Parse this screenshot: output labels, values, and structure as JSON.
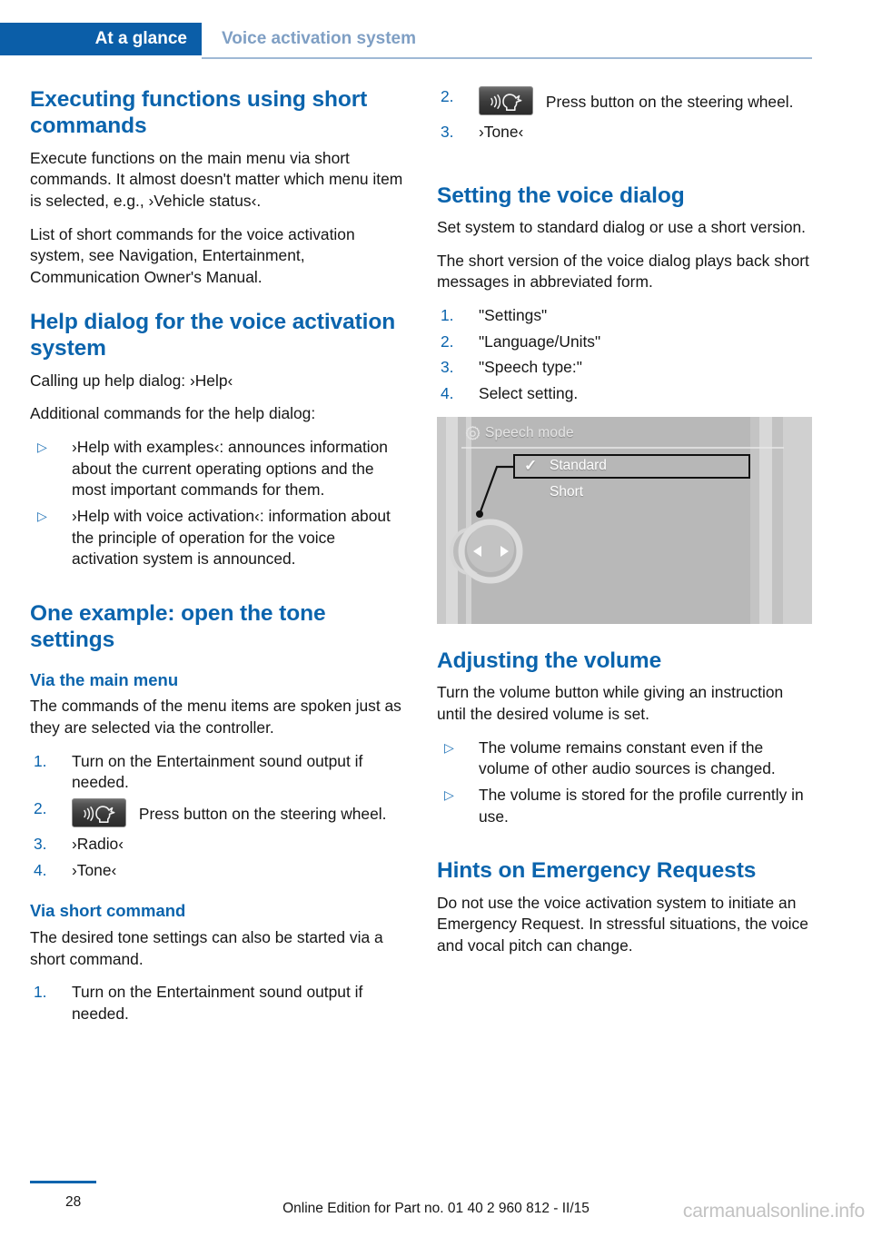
{
  "header": {
    "tab_label": "At a glance",
    "chapter_label": "Voice activation system"
  },
  "colors": {
    "brand_blue": "#0b64ad",
    "tab_blue": "#0b5ea8",
    "chapter_gray_blue": "#7f9fc4"
  },
  "left_column": {
    "section1": {
      "heading": "Executing functions using short commands",
      "paragraphs": [
        "Execute functions on the main menu via short commands. It almost doesn't matter which menu item is selected, e.g., ›Vehicle status‹.",
        "List of short commands for the voice activation system, see Navigation, Entertainment, Communication Owner's Manual."
      ]
    },
    "section2": {
      "heading": "Help dialog for the voice activation system",
      "paragraphs": [
        "Calling up help dialog: ›Help‹",
        "Additional commands for the help dialog:"
      ],
      "bullets": [
        "›Help with examples‹: announces information about the current operating options and the most important commands for them.",
        "›Help with voice activation‹: information about the principle of operation for the voice activation system is announced."
      ]
    },
    "section3": {
      "heading": "One example: open the tone settings",
      "sub1": {
        "heading": "Via the main menu",
        "paragraph": "The commands of the menu items are spoken just as they are selected via the controller.",
        "steps": [
          {
            "num": "1.",
            "text": "Turn on the Entertainment sound output if needed.",
            "icon": null
          },
          {
            "num": "2.",
            "text": "Press button on the steering wheel.",
            "icon": "voice-button-icon"
          },
          {
            "num": "3.",
            "text": "›Radio‹",
            "icon": null
          },
          {
            "num": "4.",
            "text": "›Tone‹",
            "icon": null
          }
        ]
      },
      "sub2": {
        "heading": "Via short command",
        "paragraph": "The desired tone settings can also be started via a short command.",
        "steps": [
          {
            "num": "1.",
            "text": "Turn on the Entertainment sound output if needed.",
            "icon": null
          }
        ]
      }
    }
  },
  "right_column": {
    "continued_steps": [
      {
        "num": "2.",
        "text": "Press button on the steering wheel.",
        "icon": "voice-button-icon"
      },
      {
        "num": "3.",
        "text": "›Tone‹",
        "icon": null
      }
    ],
    "section1": {
      "heading": "Setting the voice dialog",
      "paragraphs": [
        "Set system to standard dialog or use a short version.",
        "The short version of the voice dialog plays back short messages in abbreviated form."
      ],
      "steps": [
        {
          "num": "1.",
          "text": "\"Settings\""
        },
        {
          "num": "2.",
          "text": "\"Language/Units\""
        },
        {
          "num": "3.",
          "text": "\"Speech type:\""
        },
        {
          "num": "4.",
          "text": "Select setting."
        }
      ]
    },
    "figure": {
      "icon": "gear-icon",
      "title": "Speech mode",
      "options": [
        {
          "label": "Standard",
          "selected": true,
          "checkmark": "✓"
        },
        {
          "label": "Short",
          "selected": false,
          "checkmark": ""
        }
      ],
      "controller": "idrive-controller-knob"
    },
    "section2": {
      "heading": "Adjusting the volume",
      "paragraph": "Turn the volume button while giving an instruction until the desired volume is set.",
      "bullets": [
        "The volume remains constant even if the volume of other audio sources is changed.",
        "The volume is stored for the profile currently in use."
      ]
    },
    "section3": {
      "heading": "Hints on Emergency Requests",
      "paragraph": "Do not use the voice activation system to initiate an Emergency Request. In stressful situations, the voice and vocal pitch can change."
    }
  },
  "footer": {
    "page_number": "28",
    "edition": "Online Edition for Part no. 01 40 2 960 812 - II/15",
    "watermark": "carmanualsonline.info"
  }
}
